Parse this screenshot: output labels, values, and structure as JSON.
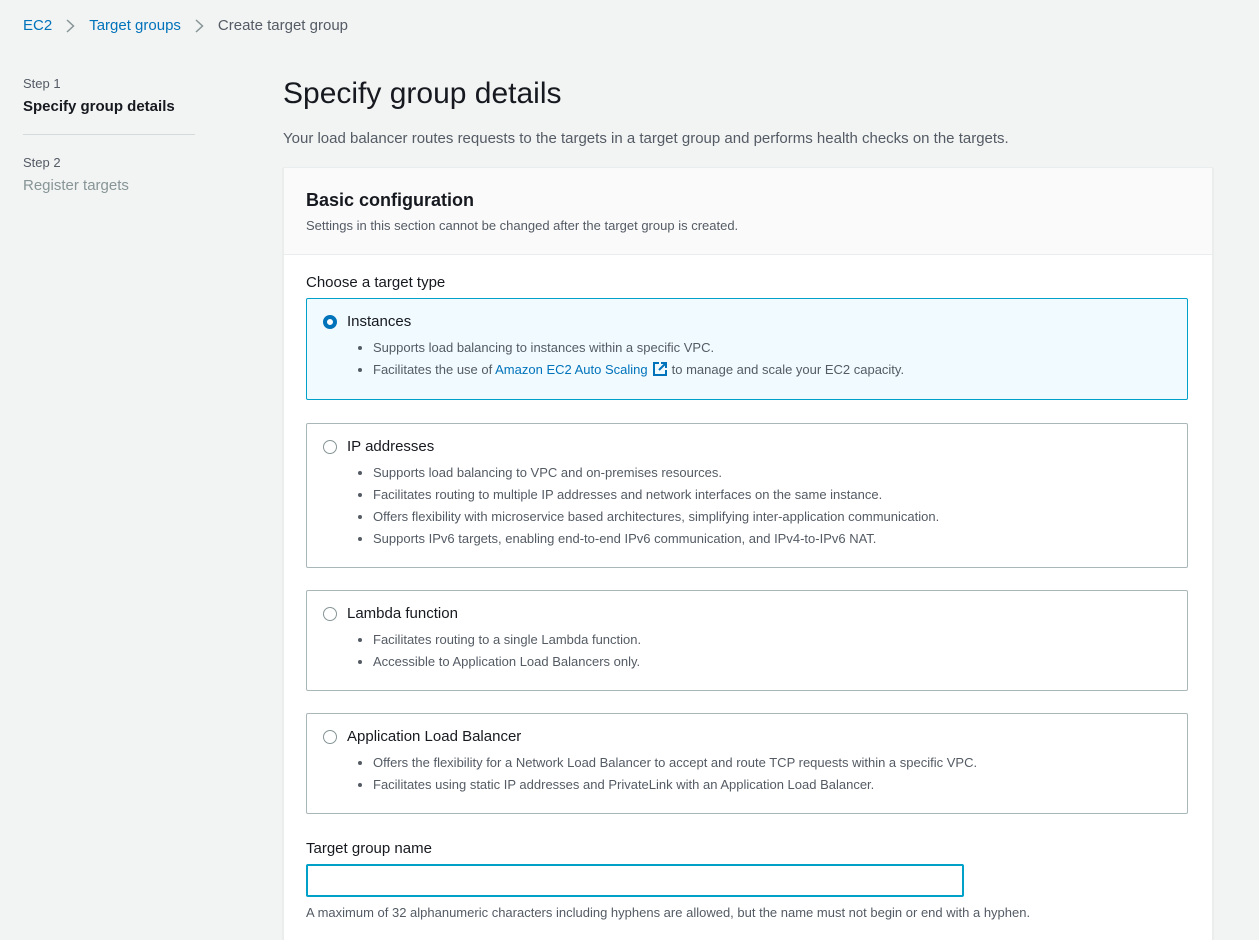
{
  "breadcrumb": {
    "items": [
      "EC2",
      "Target groups"
    ],
    "current": "Create target group"
  },
  "steps": [
    {
      "num": "Step 1",
      "title": "Specify group details"
    },
    {
      "num": "Step 2",
      "title": "Register targets"
    }
  ],
  "main": {
    "title": "Specify group details",
    "description": "Your load balancer routes requests to the targets in a target group and performs health checks on the targets."
  },
  "basic_config": {
    "title": "Basic configuration",
    "subtitle": "Settings in this section cannot be changed after the target group is created.",
    "target_type_label": "Choose a target type",
    "options": [
      {
        "title": "Instances",
        "selected": true,
        "bullets": [
          "Supports load balancing to instances within a specific VPC."
        ],
        "bullet_link": {
          "before": "Facilitates the use of",
          "link": "Amazon EC2 Auto Scaling",
          "after": "to manage and scale your EC2 capacity."
        }
      },
      {
        "title": "IP addresses",
        "selected": false,
        "bullets": [
          "Supports load balancing to VPC and on-premises resources.",
          "Facilitates routing to multiple IP addresses and network interfaces on the same instance.",
          "Offers flexibility with microservice based architectures, simplifying inter-application communication.",
          "Supports IPv6 targets, enabling end-to-end IPv6 communication, and IPv4-to-IPv6 NAT."
        ]
      },
      {
        "title": "Lambda function",
        "selected": false,
        "bullets": [
          "Facilitates routing to a single Lambda function.",
          "Accessible to Application Load Balancers only."
        ]
      },
      {
        "title": "Application Load Balancer",
        "selected": false,
        "bullets": [
          "Offers the flexibility for a Network Load Balancer to accept and route TCP requests within a specific VPC.",
          "Facilitates using static IP addresses and PrivateLink with an Application Load Balancer."
        ]
      }
    ],
    "name_label": "Target group name",
    "name_value": "",
    "name_hint": "A maximum of 32 alphanumeric characters including hyphens are allowed, but the name must not begin or end with a hyphen."
  },
  "colors": {
    "link": "#0073bb",
    "selected_border": "#00a1c9",
    "selected_bg": "#f1faff"
  }
}
